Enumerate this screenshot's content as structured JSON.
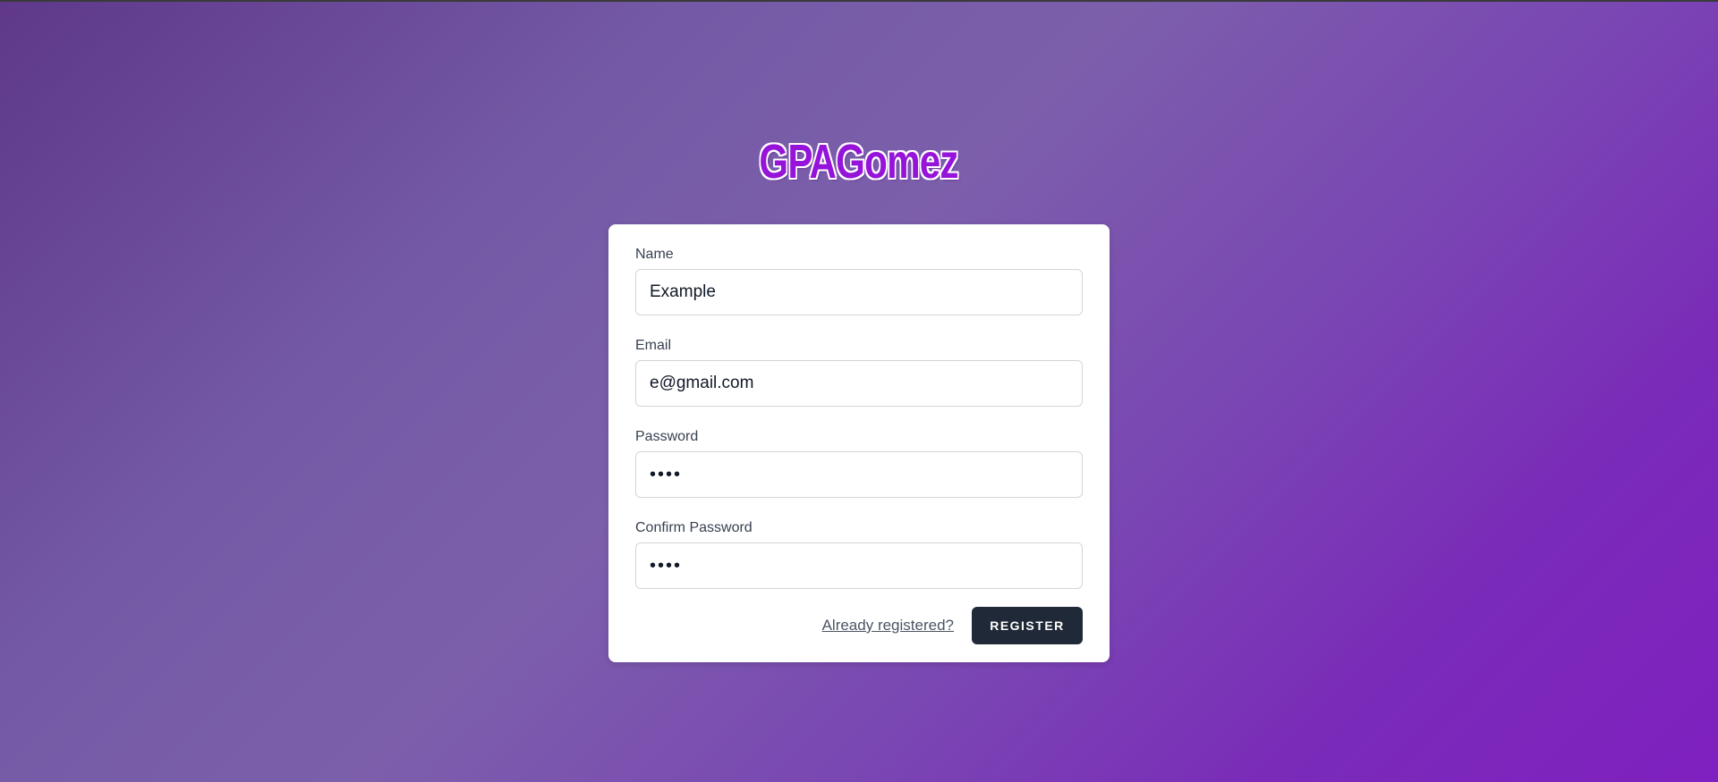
{
  "app": {
    "brand": "GPAGomez"
  },
  "form": {
    "name": {
      "label": "Name",
      "value": "Example"
    },
    "email": {
      "label": "Email",
      "value": "e@gmail.com"
    },
    "password": {
      "label": "Password",
      "value": "••••"
    },
    "confirm_password": {
      "label": "Confirm Password",
      "value": "••••"
    },
    "login_link": "Already registered?",
    "register_button": "REGISTER"
  },
  "colors": {
    "brand": "#9614d9",
    "button_bg": "#1f2937",
    "background_start": "#5f3889",
    "background_end": "#7f20c0"
  }
}
